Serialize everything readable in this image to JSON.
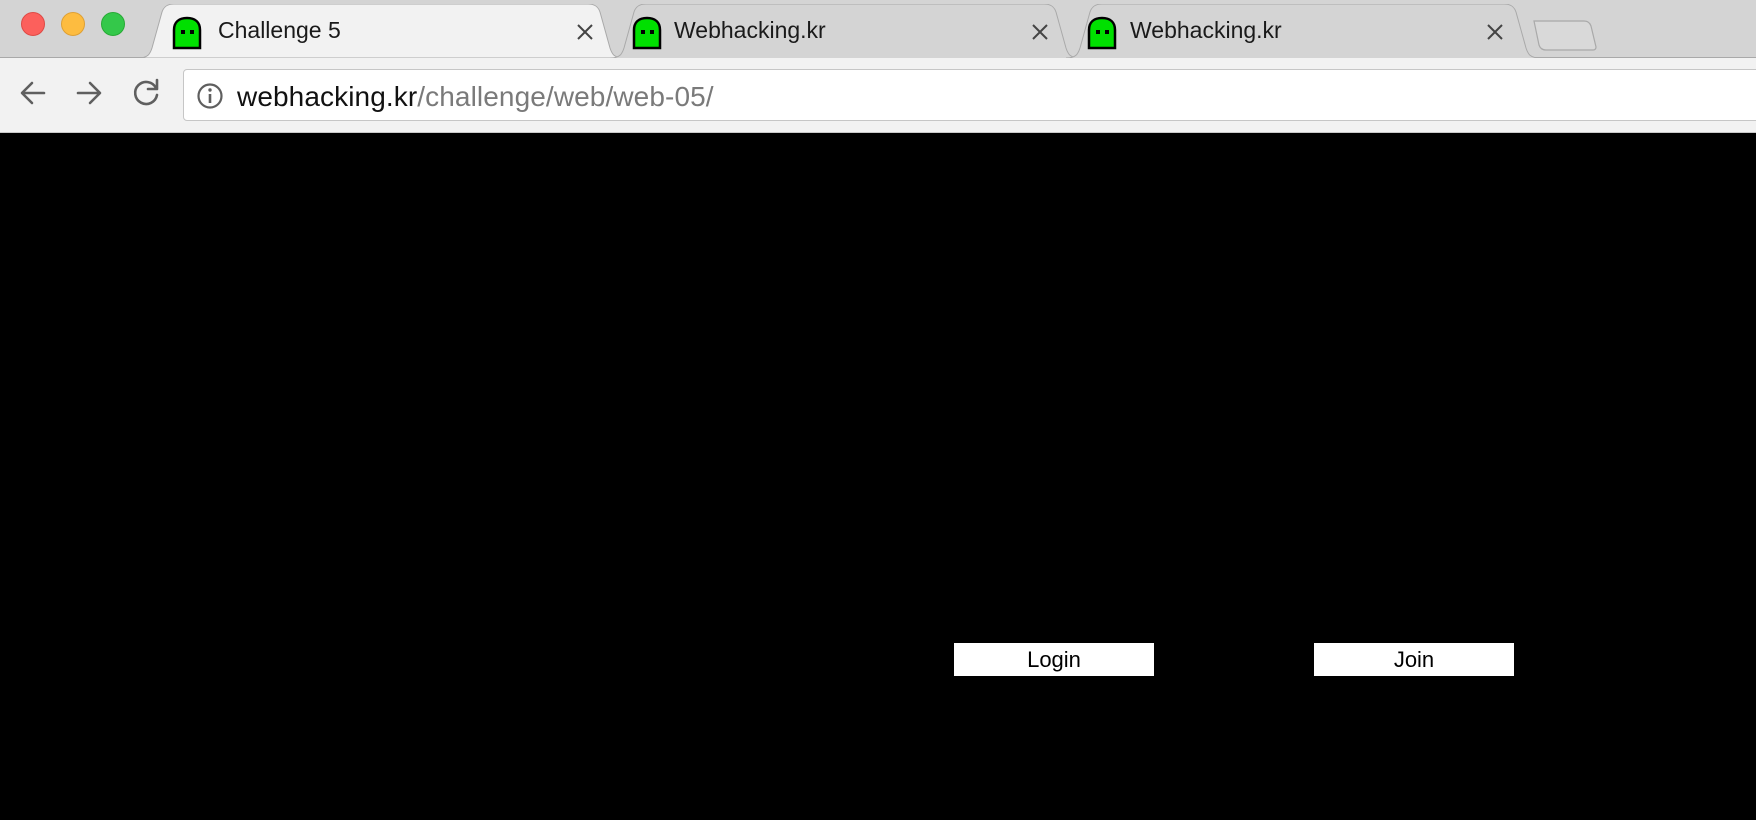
{
  "window": {
    "controls": [
      "close",
      "minimize",
      "maximize"
    ]
  },
  "tabs": [
    {
      "title": "Challenge 5",
      "active": true,
      "favicon": "green-ghost-icon"
    },
    {
      "title": "Webhacking.kr",
      "active": false,
      "favicon": "green-ghost-icon"
    },
    {
      "title": "Webhacking.kr",
      "active": false,
      "favicon": "green-ghost-icon"
    }
  ],
  "toolbar": {
    "url_host": "webhacking.kr",
    "url_path": "/challenge/web/web-05/"
  },
  "page": {
    "background": "#000000",
    "login_label": "Login",
    "join_label": "Join"
  },
  "colors": {
    "favicon_green": "#00e000",
    "tabstrip": "#d4d4d4",
    "active_tab": "#f2f2f2"
  }
}
